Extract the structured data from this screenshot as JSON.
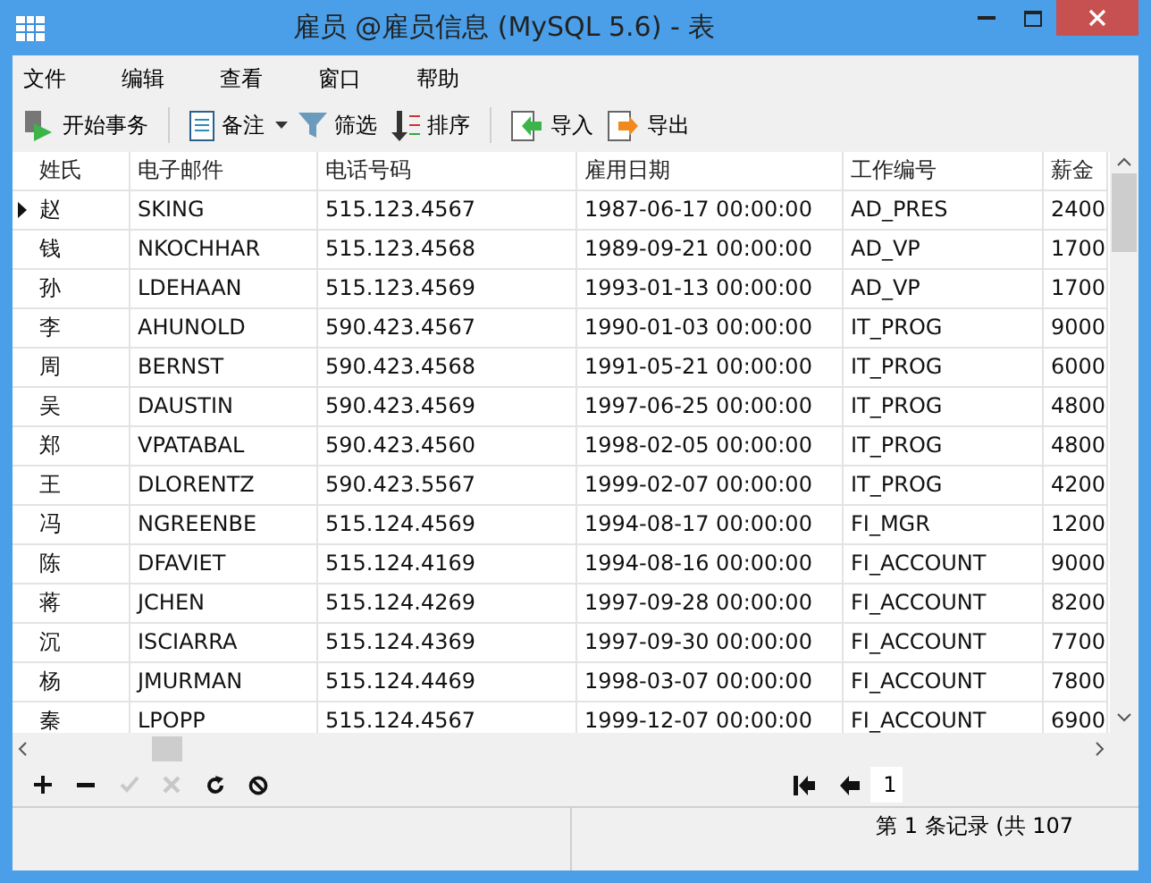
{
  "window": {
    "title": "雇员 @雇员信息 (MySQL 5.6) - 表"
  },
  "menu": [
    "文件",
    "编辑",
    "查看",
    "窗口",
    "帮助"
  ],
  "toolbar": [
    {
      "kind": "transaction",
      "label": "开始事务"
    },
    {
      "kind": "separator"
    },
    {
      "kind": "note",
      "label": "备注",
      "dropdown": true
    },
    {
      "kind": "filter",
      "label": "筛选"
    },
    {
      "kind": "sort",
      "label": "排序"
    },
    {
      "kind": "separator"
    },
    {
      "kind": "import",
      "label": "导入"
    },
    {
      "kind": "export",
      "label": "导出"
    }
  ],
  "table": {
    "columns": [
      "姓氏",
      "电子邮件",
      "电话号码",
      "雇用日期",
      "工作编号",
      "薪金"
    ],
    "rows": [
      {
        "selected": true,
        "cells": [
          "赵",
          "SKING",
          "515.123.4567",
          "1987-06-17 00:00:00",
          "AD_PRES",
          "2400"
        ]
      },
      {
        "selected": false,
        "cells": [
          "钱",
          "NKOCHHAR",
          "515.123.4568",
          "1989-09-21 00:00:00",
          "AD_VP",
          "1700"
        ]
      },
      {
        "selected": false,
        "cells": [
          "孙",
          "LDEHAAN",
          "515.123.4569",
          "1993-01-13 00:00:00",
          "AD_VP",
          "1700"
        ]
      },
      {
        "selected": false,
        "cells": [
          "李",
          "AHUNOLD",
          "590.423.4567",
          "1990-01-03 00:00:00",
          "IT_PROG",
          "9000"
        ]
      },
      {
        "selected": false,
        "cells": [
          "周",
          "BERNST",
          "590.423.4568",
          "1991-05-21 00:00:00",
          "IT_PROG",
          "6000"
        ]
      },
      {
        "selected": false,
        "cells": [
          "吴",
          "DAUSTIN",
          "590.423.4569",
          "1997-06-25 00:00:00",
          "IT_PROG",
          "4800"
        ]
      },
      {
        "selected": false,
        "cells": [
          "郑",
          "VPATABAL",
          "590.423.4560",
          "1998-02-05 00:00:00",
          "IT_PROG",
          "4800"
        ]
      },
      {
        "selected": false,
        "cells": [
          "王",
          "DLORENTZ",
          "590.423.5567",
          "1999-02-07 00:00:00",
          "IT_PROG",
          "4200"
        ]
      },
      {
        "selected": false,
        "cells": [
          "冯",
          "NGREENBE",
          "515.124.4569",
          "1994-08-17 00:00:00",
          "FI_MGR",
          "1200"
        ]
      },
      {
        "selected": false,
        "cells": [
          "陈",
          "DFAVIET",
          "515.124.4169",
          "1994-08-16 00:00:00",
          "FI_ACCOUNT",
          "9000"
        ]
      },
      {
        "selected": false,
        "cells": [
          "蒋",
          "JCHEN",
          "515.124.4269",
          "1997-09-28 00:00:00",
          "FI_ACCOUNT",
          "8200"
        ]
      },
      {
        "selected": false,
        "cells": [
          "沉",
          "ISCIARRA",
          "515.124.4369",
          "1997-09-30 00:00:00",
          "FI_ACCOUNT",
          "7700"
        ]
      },
      {
        "selected": false,
        "cells": [
          "杨",
          "JMURMAN",
          "515.124.4469",
          "1998-03-07 00:00:00",
          "FI_ACCOUNT",
          "7800"
        ]
      },
      {
        "selected": false,
        "cells": [
          "秦",
          "LPOPP",
          "515.124.4567",
          "1999-12-07 00:00:00",
          "FI_ACCOUNT",
          "6900"
        ]
      }
    ]
  },
  "record_actions": [
    {
      "kind": "add",
      "disabled": false
    },
    {
      "kind": "delete",
      "disabled": false
    },
    {
      "kind": "apply",
      "disabled": true
    },
    {
      "kind": "discard",
      "disabled": true
    },
    {
      "kind": "refresh",
      "disabled": false
    },
    {
      "kind": "stop",
      "disabled": false
    }
  ],
  "pager": {
    "page": "1"
  },
  "status_bar": {
    "text": "第 1 条记录 (共 107"
  }
}
